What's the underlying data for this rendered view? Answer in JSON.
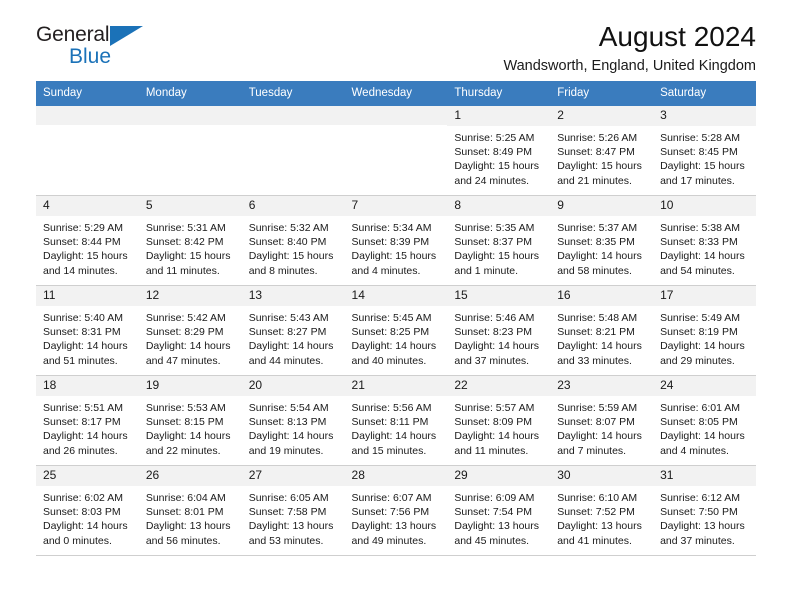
{
  "brand": {
    "line1": "General",
    "line2": "Blue",
    "triangle_color": "#1b72b8",
    "text_color": "#231f20"
  },
  "header": {
    "title": "August 2024",
    "subtitle": "Wandsworth, England, United Kingdom"
  },
  "theme": {
    "header_bg": "#3a7cbe",
    "header_text": "#ffffff",
    "daynum_bg": "#f2f2f2",
    "cell_bg": "#ffffff",
    "grid_line": "#cfcfcf"
  },
  "weekday_headers": [
    "Sunday",
    "Monday",
    "Tuesday",
    "Wednesday",
    "Thursday",
    "Friday",
    "Saturday"
  ],
  "labels": {
    "sunrise_prefix": "Sunrise:",
    "sunset_prefix": "Sunset:",
    "daylight_prefix": "Daylight:"
  },
  "weeks": [
    [
      {
        "day": "",
        "empty": true
      },
      {
        "day": "",
        "empty": true
      },
      {
        "day": "",
        "empty": true
      },
      {
        "day": "",
        "empty": true
      },
      {
        "day": "1",
        "sunrise": "Sunrise: 5:25 AM",
        "sunset": "Sunset: 8:49 PM",
        "daylight_line1": "Daylight: 15 hours",
        "daylight_line2": "and 24 minutes."
      },
      {
        "day": "2",
        "sunrise": "Sunrise: 5:26 AM",
        "sunset": "Sunset: 8:47 PM",
        "daylight_line1": "Daylight: 15 hours",
        "daylight_line2": "and 21 minutes."
      },
      {
        "day": "3",
        "sunrise": "Sunrise: 5:28 AM",
        "sunset": "Sunset: 8:45 PM",
        "daylight_line1": "Daylight: 15 hours",
        "daylight_line2": "and 17 minutes."
      }
    ],
    [
      {
        "day": "4",
        "sunrise": "Sunrise: 5:29 AM",
        "sunset": "Sunset: 8:44 PM",
        "daylight_line1": "Daylight: 15 hours",
        "daylight_line2": "and 14 minutes."
      },
      {
        "day": "5",
        "sunrise": "Sunrise: 5:31 AM",
        "sunset": "Sunset: 8:42 PM",
        "daylight_line1": "Daylight: 15 hours",
        "daylight_line2": "and 11 minutes."
      },
      {
        "day": "6",
        "sunrise": "Sunrise: 5:32 AM",
        "sunset": "Sunset: 8:40 PM",
        "daylight_line1": "Daylight: 15 hours",
        "daylight_line2": "and 8 minutes."
      },
      {
        "day": "7",
        "sunrise": "Sunrise: 5:34 AM",
        "sunset": "Sunset: 8:39 PM",
        "daylight_line1": "Daylight: 15 hours",
        "daylight_line2": "and 4 minutes."
      },
      {
        "day": "8",
        "sunrise": "Sunrise: 5:35 AM",
        "sunset": "Sunset: 8:37 PM",
        "daylight_line1": "Daylight: 15 hours",
        "daylight_line2": "and 1 minute."
      },
      {
        "day": "9",
        "sunrise": "Sunrise: 5:37 AM",
        "sunset": "Sunset: 8:35 PM",
        "daylight_line1": "Daylight: 14 hours",
        "daylight_line2": "and 58 minutes."
      },
      {
        "day": "10",
        "sunrise": "Sunrise: 5:38 AM",
        "sunset": "Sunset: 8:33 PM",
        "daylight_line1": "Daylight: 14 hours",
        "daylight_line2": "and 54 minutes."
      }
    ],
    [
      {
        "day": "11",
        "sunrise": "Sunrise: 5:40 AM",
        "sunset": "Sunset: 8:31 PM",
        "daylight_line1": "Daylight: 14 hours",
        "daylight_line2": "and 51 minutes."
      },
      {
        "day": "12",
        "sunrise": "Sunrise: 5:42 AM",
        "sunset": "Sunset: 8:29 PM",
        "daylight_line1": "Daylight: 14 hours",
        "daylight_line2": "and 47 minutes."
      },
      {
        "day": "13",
        "sunrise": "Sunrise: 5:43 AM",
        "sunset": "Sunset: 8:27 PM",
        "daylight_line1": "Daylight: 14 hours",
        "daylight_line2": "and 44 minutes."
      },
      {
        "day": "14",
        "sunrise": "Sunrise: 5:45 AM",
        "sunset": "Sunset: 8:25 PM",
        "daylight_line1": "Daylight: 14 hours",
        "daylight_line2": "and 40 minutes."
      },
      {
        "day": "15",
        "sunrise": "Sunrise: 5:46 AM",
        "sunset": "Sunset: 8:23 PM",
        "daylight_line1": "Daylight: 14 hours",
        "daylight_line2": "and 37 minutes."
      },
      {
        "day": "16",
        "sunrise": "Sunrise: 5:48 AM",
        "sunset": "Sunset: 8:21 PM",
        "daylight_line1": "Daylight: 14 hours",
        "daylight_line2": "and 33 minutes."
      },
      {
        "day": "17",
        "sunrise": "Sunrise: 5:49 AM",
        "sunset": "Sunset: 8:19 PM",
        "daylight_line1": "Daylight: 14 hours",
        "daylight_line2": "and 29 minutes."
      }
    ],
    [
      {
        "day": "18",
        "sunrise": "Sunrise: 5:51 AM",
        "sunset": "Sunset: 8:17 PM",
        "daylight_line1": "Daylight: 14 hours",
        "daylight_line2": "and 26 minutes."
      },
      {
        "day": "19",
        "sunrise": "Sunrise: 5:53 AM",
        "sunset": "Sunset: 8:15 PM",
        "daylight_line1": "Daylight: 14 hours",
        "daylight_line2": "and 22 minutes."
      },
      {
        "day": "20",
        "sunrise": "Sunrise: 5:54 AM",
        "sunset": "Sunset: 8:13 PM",
        "daylight_line1": "Daylight: 14 hours",
        "daylight_line2": "and 19 minutes."
      },
      {
        "day": "21",
        "sunrise": "Sunrise: 5:56 AM",
        "sunset": "Sunset: 8:11 PM",
        "daylight_line1": "Daylight: 14 hours",
        "daylight_line2": "and 15 minutes."
      },
      {
        "day": "22",
        "sunrise": "Sunrise: 5:57 AM",
        "sunset": "Sunset: 8:09 PM",
        "daylight_line1": "Daylight: 14 hours",
        "daylight_line2": "and 11 minutes."
      },
      {
        "day": "23",
        "sunrise": "Sunrise: 5:59 AM",
        "sunset": "Sunset: 8:07 PM",
        "daylight_line1": "Daylight: 14 hours",
        "daylight_line2": "and 7 minutes."
      },
      {
        "day": "24",
        "sunrise": "Sunrise: 6:01 AM",
        "sunset": "Sunset: 8:05 PM",
        "daylight_line1": "Daylight: 14 hours",
        "daylight_line2": "and 4 minutes."
      }
    ],
    [
      {
        "day": "25",
        "sunrise": "Sunrise: 6:02 AM",
        "sunset": "Sunset: 8:03 PM",
        "daylight_line1": "Daylight: 14 hours",
        "daylight_line2": "and 0 minutes."
      },
      {
        "day": "26",
        "sunrise": "Sunrise: 6:04 AM",
        "sunset": "Sunset: 8:01 PM",
        "daylight_line1": "Daylight: 13 hours",
        "daylight_line2": "and 56 minutes."
      },
      {
        "day": "27",
        "sunrise": "Sunrise: 6:05 AM",
        "sunset": "Sunset: 7:58 PM",
        "daylight_line1": "Daylight: 13 hours",
        "daylight_line2": "and 53 minutes."
      },
      {
        "day": "28",
        "sunrise": "Sunrise: 6:07 AM",
        "sunset": "Sunset: 7:56 PM",
        "daylight_line1": "Daylight: 13 hours",
        "daylight_line2": "and 49 minutes."
      },
      {
        "day": "29",
        "sunrise": "Sunrise: 6:09 AM",
        "sunset": "Sunset: 7:54 PM",
        "daylight_line1": "Daylight: 13 hours",
        "daylight_line2": "and 45 minutes."
      },
      {
        "day": "30",
        "sunrise": "Sunrise: 6:10 AM",
        "sunset": "Sunset: 7:52 PM",
        "daylight_line1": "Daylight: 13 hours",
        "daylight_line2": "and 41 minutes."
      },
      {
        "day": "31",
        "sunrise": "Sunrise: 6:12 AM",
        "sunset": "Sunset: 7:50 PM",
        "daylight_line1": "Daylight: 13 hours",
        "daylight_line2": "and 37 minutes."
      }
    ]
  ]
}
